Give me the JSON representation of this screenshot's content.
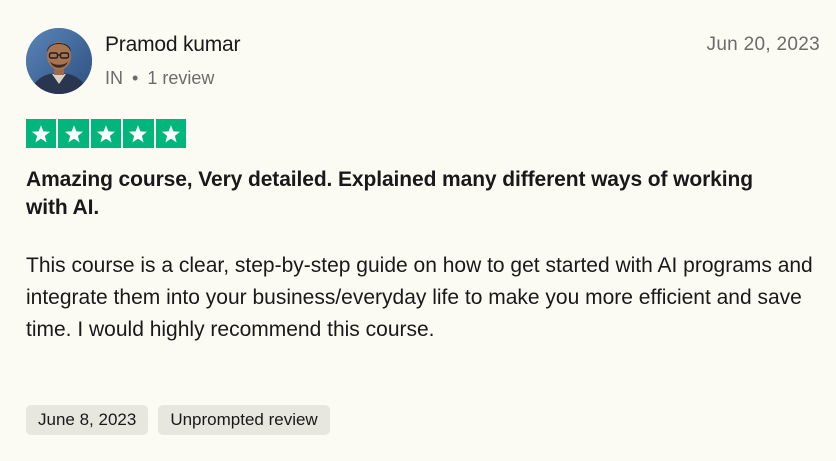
{
  "review": {
    "reviewer": {
      "name": "Pramod kumar",
      "country": "IN",
      "separator": "•",
      "review_count": "1 review",
      "avatar_icon": "reviewer-avatar-photo"
    },
    "date_posted": "Jun 20, 2023",
    "rating": {
      "stars": 5,
      "out_of": 5,
      "star_color": "#00b67a",
      "icon": "star-icon"
    },
    "title": "Amazing course, Very detailed. Explained many different ways of working with AI.",
    "body": "This course is a clear, step-by-step guide on how to get started with AI programs and integrate them into your business/everyday life to make you more efficient and save time. I would highly recommend this course.",
    "tags": {
      "experience_date": "June 8, 2023",
      "review_type": "Unprompted review"
    }
  },
  "colors": {
    "background": "#fcfbf3",
    "text_primary": "#191919",
    "text_secondary": "#6b6b6b",
    "tag_background": "#e7e6df"
  }
}
